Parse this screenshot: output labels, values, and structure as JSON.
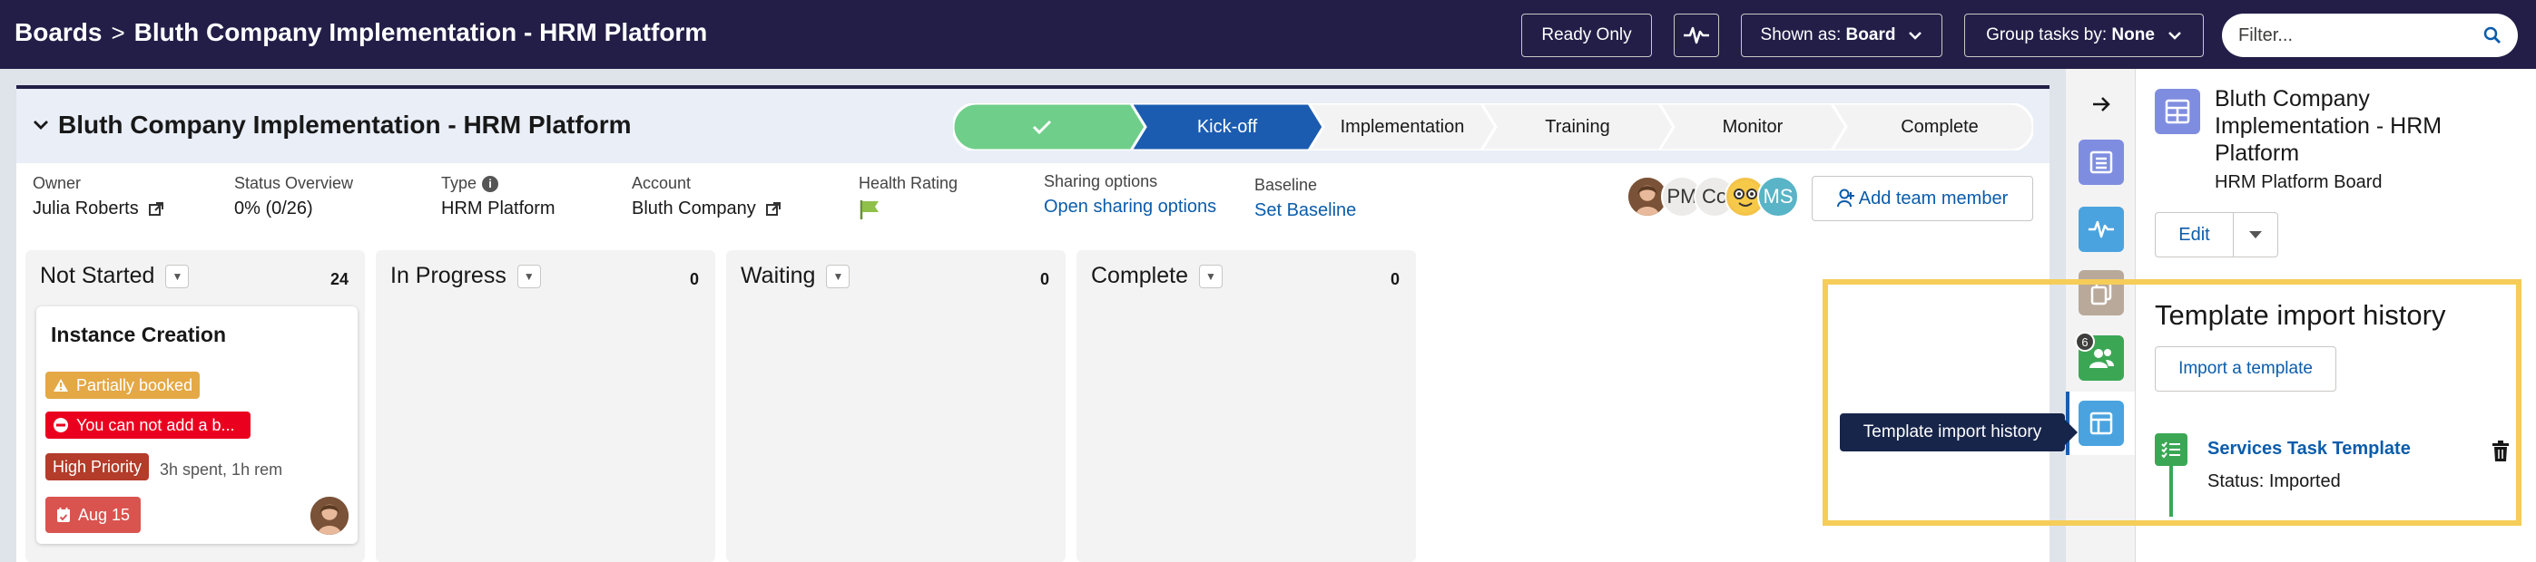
{
  "topbar": {
    "breadcrumb_root": "Boards",
    "breadcrumb_current": "Bluth Company Implementation - HRM Platform",
    "ready_only_label": "Ready Only",
    "shown_as_prefix": "Shown as:",
    "shown_as_value": "Board",
    "group_by_prefix": "Group tasks by:",
    "group_by_value": "None",
    "filter_placeholder": "Filter..."
  },
  "board": {
    "title": "Bluth Company Implementation - HRM Platform",
    "stages": [
      {
        "label": "",
        "state": "completed"
      },
      {
        "label": "Kick-off",
        "state": "current"
      },
      {
        "label": "Implementation",
        "state": "upcoming"
      },
      {
        "label": "Training",
        "state": "upcoming"
      },
      {
        "label": "Monitor",
        "state": "upcoming"
      },
      {
        "label": "Complete",
        "state": "upcoming"
      }
    ],
    "fields": {
      "owner_label": "Owner",
      "owner_value": "Julia Roberts",
      "status_label": "Status Overview",
      "status_value": "0% (0/26)",
      "type_label": "Type",
      "type_value": "HRM Platform",
      "account_label": "Account",
      "account_value": "Bluth Company",
      "health_label": "Health Rating",
      "sharing_label": "Sharing options",
      "sharing_link": "Open sharing options",
      "baseline_label": "Baseline",
      "baseline_link": "Set Baseline"
    },
    "team_avatars": [
      {
        "initials": "",
        "kind": "photo"
      },
      {
        "initials": "PM",
        "kind": "initials"
      },
      {
        "initials": "Co",
        "kind": "initials"
      },
      {
        "initials": "",
        "kind": "emoji"
      },
      {
        "initials": "MS",
        "kind": "initials"
      }
    ],
    "add_member_label": "Add team member",
    "columns": [
      {
        "name": "Not Started",
        "count": "24"
      },
      {
        "name": "In Progress",
        "count": "0"
      },
      {
        "name": "Waiting",
        "count": "0"
      },
      {
        "name": "Complete",
        "count": "0"
      }
    ],
    "card": {
      "title": "Instance Creation",
      "warning_badge": "Partially booked",
      "error_badge": "You can not add a b...",
      "priority_badge": "High Priority",
      "time": "3h spent, 1h rem",
      "date": "Aug 15"
    }
  },
  "rail": {
    "notification_count": "6"
  },
  "detail": {
    "title": "Bluth Company Implementation - HRM Platform",
    "subtitle": "HRM Platform Board",
    "edit_label": "Edit",
    "tooltip": "Template import history",
    "section_title": "Template import history",
    "import_button": "Import a template",
    "template_name": "Services Task Template",
    "template_status": "Status: Imported"
  },
  "colors": {
    "topbar": "#221e48",
    "stage_completed": "#6fcf8a",
    "stage_current": "#1b5cb0",
    "stage_upcoming": "#f3f3f3",
    "highlight": "#f5cd58",
    "link": "#0b5cab"
  }
}
